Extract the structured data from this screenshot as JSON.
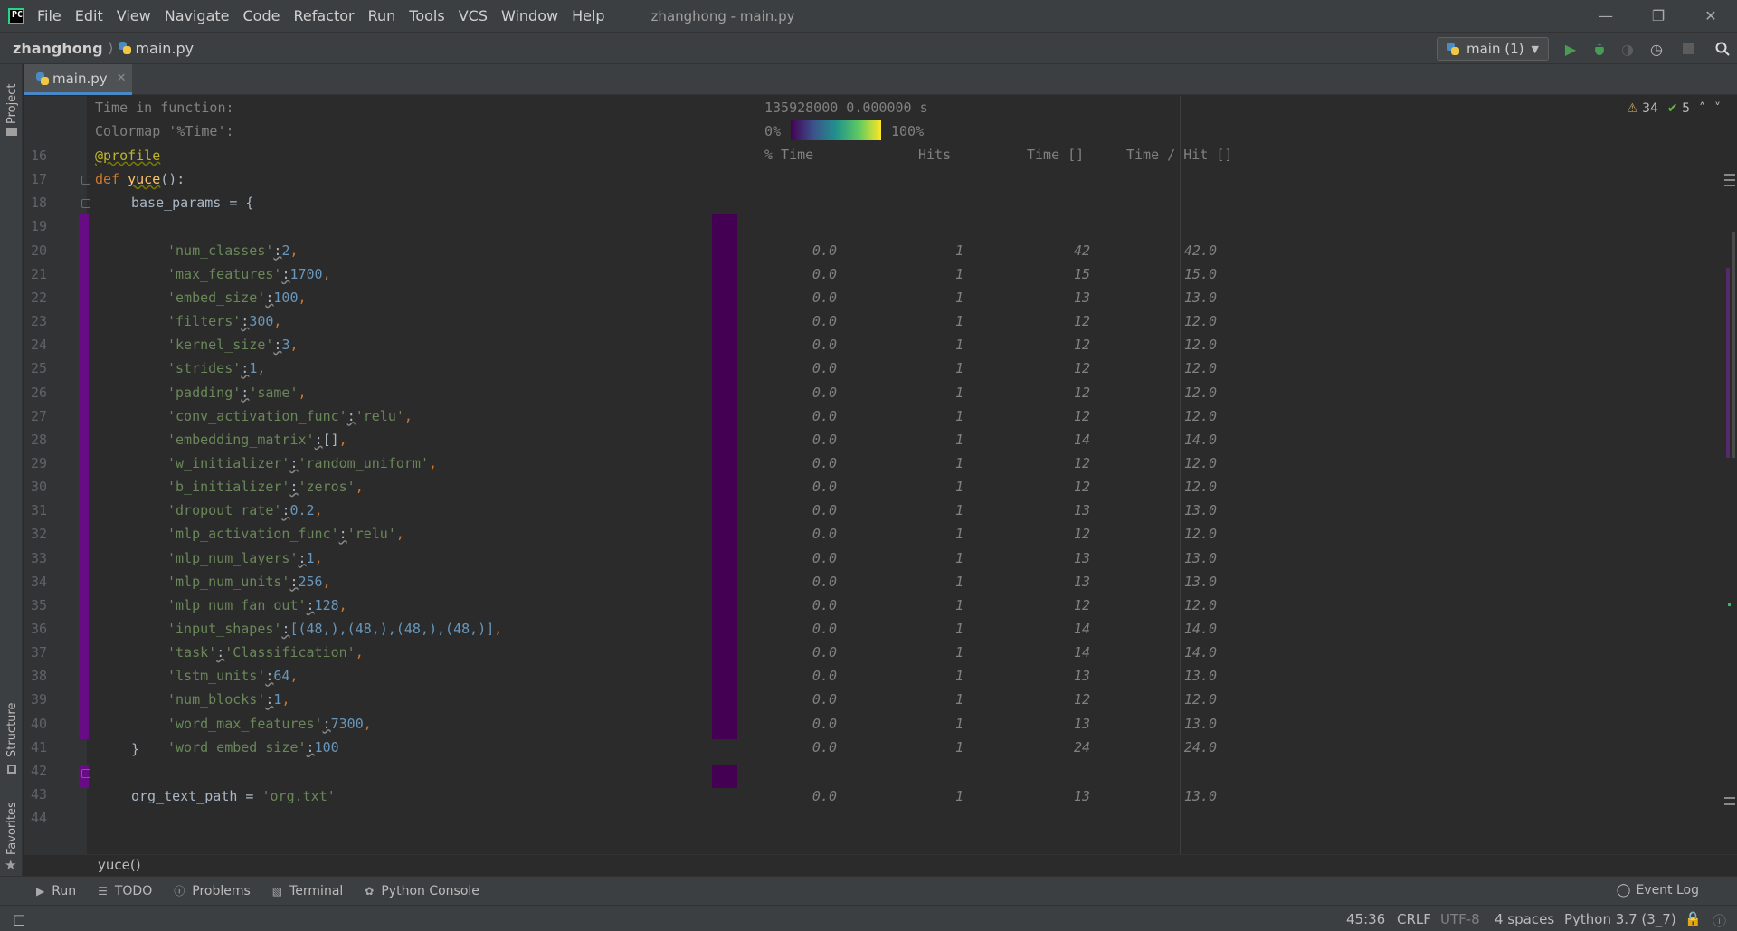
{
  "menubar": {
    "items": [
      "File",
      "Edit",
      "View",
      "Navigate",
      "Code",
      "Refactor",
      "Run",
      "Tools",
      "VCS",
      "Window",
      "Help"
    ],
    "window_title": "zhanghong - main.py"
  },
  "navbar": {
    "project": "zhanghong",
    "file": "main.py",
    "run_config": "main (1)"
  },
  "left_strip": {
    "project": "Project",
    "structure": "Structure",
    "favorites": "Favorites"
  },
  "tab": {
    "label": "main.py"
  },
  "inspections": {
    "warnings": "34",
    "weak_warnings": "5"
  },
  "profiler": {
    "time_in_function_label": "Time in function:",
    "time_in_function_value": "135928000 0.000000 s",
    "colormap_label": "Colormap '%Time':",
    "colormap_min": "0%",
    "colormap_max": "100%",
    "col_time_pct": "% Time",
    "col_hits": "Hits",
    "col_time": "Time []",
    "col_time_per_hit": "Time / Hit []"
  },
  "lines": [
    {
      "n": "16"
    },
    {
      "n": "17"
    },
    {
      "n": "18"
    },
    {
      "n": "19"
    },
    {
      "n": "20"
    },
    {
      "n": "21"
    },
    {
      "n": "22"
    },
    {
      "n": "23"
    },
    {
      "n": "24"
    },
    {
      "n": "25"
    },
    {
      "n": "26"
    },
    {
      "n": "27"
    },
    {
      "n": "28"
    },
    {
      "n": "29"
    },
    {
      "n": "30"
    },
    {
      "n": "31"
    },
    {
      "n": "32"
    },
    {
      "n": "33"
    },
    {
      "n": "34"
    },
    {
      "n": "35"
    },
    {
      "n": "36"
    },
    {
      "n": "37"
    },
    {
      "n": "38"
    },
    {
      "n": "39"
    },
    {
      "n": "40"
    },
    {
      "n": "41"
    },
    {
      "n": "42"
    },
    {
      "n": "43"
    },
    {
      "n": "44"
    }
  ],
  "code": {
    "l16": "@profile",
    "l17_kw": "def",
    "l17_fn": "yuce",
    "l17_rest": "():",
    "l19": "base_params = {",
    "params": [
      {
        "key": "'num_classes'",
        "val": "2",
        "type": "num"
      },
      {
        "key": "'max_features'",
        "val": "1700",
        "type": "num"
      },
      {
        "key": "'embed_size'",
        "val": "100",
        "type": "num"
      },
      {
        "key": "'filters'",
        "val": "300",
        "type": "num"
      },
      {
        "key": "'kernel_size'",
        "val": "3",
        "type": "num"
      },
      {
        "key": "'strides'",
        "val": "1",
        "type": "num"
      },
      {
        "key": "'padding'",
        "val": "'same'",
        "type": "str"
      },
      {
        "key": "'conv_activation_func'",
        "val": "'relu'",
        "type": "str"
      },
      {
        "key": "'embedding_matrix'",
        "val": "[]",
        "type": "plain"
      },
      {
        "key": "'w_initializer'",
        "val": "'random_uniform'",
        "type": "str"
      },
      {
        "key": "'b_initializer'",
        "val": "'zeros'",
        "type": "str"
      },
      {
        "key": "'dropout_rate'",
        "val": "0.2",
        "type": "num"
      },
      {
        "key": "'mlp_activation_func'",
        "val": "'relu'",
        "type": "str"
      },
      {
        "key": "'mlp_num_layers'",
        "val": "1",
        "type": "num"
      },
      {
        "key": "'mlp_num_units'",
        "val": "256",
        "type": "num"
      },
      {
        "key": "'mlp_num_fan_out'",
        "val": "128",
        "type": "num"
      },
      {
        "key": "'input_shapes'",
        "val": "[(48,),(48,),(48,),(48,)]",
        "type": "shapes"
      },
      {
        "key": "'task'",
        "val": "'Classification'",
        "type": "str"
      },
      {
        "key": "'lstm_units'",
        "val": "64",
        "type": "num"
      },
      {
        "key": "'num_blocks'",
        "val": "1",
        "type": "num"
      },
      {
        "key": "'word_max_features'",
        "val": "7300",
        "type": "num"
      },
      {
        "key": "'word_embed_size'",
        "val": "100",
        "type": "num"
      }
    ],
    "l42": "}",
    "l44_lhs": "org_text_path = ",
    "l44_str": "'org.txt'"
  },
  "stats": [
    {
      "pct": "0.0",
      "hits": "1",
      "time": "42",
      "tph": "42.0"
    },
    {
      "pct": "0.0",
      "hits": "1",
      "time": "15",
      "tph": "15.0"
    },
    {
      "pct": "0.0",
      "hits": "1",
      "time": "13",
      "tph": "13.0"
    },
    {
      "pct": "0.0",
      "hits": "1",
      "time": "12",
      "tph": "12.0"
    },
    {
      "pct": "0.0",
      "hits": "1",
      "time": "12",
      "tph": "12.0"
    },
    {
      "pct": "0.0",
      "hits": "1",
      "time": "12",
      "tph": "12.0"
    },
    {
      "pct": "0.0",
      "hits": "1",
      "time": "12",
      "tph": "12.0"
    },
    {
      "pct": "0.0",
      "hits": "1",
      "time": "12",
      "tph": "12.0"
    },
    {
      "pct": "0.0",
      "hits": "1",
      "time": "14",
      "tph": "14.0"
    },
    {
      "pct": "0.0",
      "hits": "1",
      "time": "12",
      "tph": "12.0"
    },
    {
      "pct": "0.0",
      "hits": "1",
      "time": "12",
      "tph": "12.0"
    },
    {
      "pct": "0.0",
      "hits": "1",
      "time": "13",
      "tph": "13.0"
    },
    {
      "pct": "0.0",
      "hits": "1",
      "time": "12",
      "tph": "12.0"
    },
    {
      "pct": "0.0",
      "hits": "1",
      "time": "13",
      "tph": "13.0"
    },
    {
      "pct": "0.0",
      "hits": "1",
      "time": "13",
      "tph": "13.0"
    },
    {
      "pct": "0.0",
      "hits": "1",
      "time": "12",
      "tph": "12.0"
    },
    {
      "pct": "0.0",
      "hits": "1",
      "time": "14",
      "tph": "14.0"
    },
    {
      "pct": "0.0",
      "hits": "1",
      "time": "14",
      "tph": "14.0"
    },
    {
      "pct": "0.0",
      "hits": "1",
      "time": "13",
      "tph": "13.0"
    },
    {
      "pct": "0.0",
      "hits": "1",
      "time": "12",
      "tph": "12.0"
    },
    {
      "pct": "0.0",
      "hits": "1",
      "time": "13",
      "tph": "13.0"
    },
    {
      "pct": "0.0",
      "hits": "1",
      "time": "24",
      "tph": "24.0"
    }
  ],
  "stats_l44": {
    "pct": "0.0",
    "hits": "1",
    "time": "13",
    "tph": "13.0"
  },
  "code_crumb": "yuce()",
  "tool_tabs": [
    "Run",
    "TODO",
    "Problems",
    "Terminal",
    "Python Console"
  ],
  "event_log": "Event Log",
  "status": {
    "position": "45:36",
    "line_sep": "CRLF",
    "encoding": "UTF-8",
    "indent": "4 spaces",
    "interpreter": "Python 3.7 (3_7)"
  },
  "colors": {
    "hit_bar": "#440154",
    "gutter_mark": "#680c86",
    "accent": "#4a88c7"
  }
}
